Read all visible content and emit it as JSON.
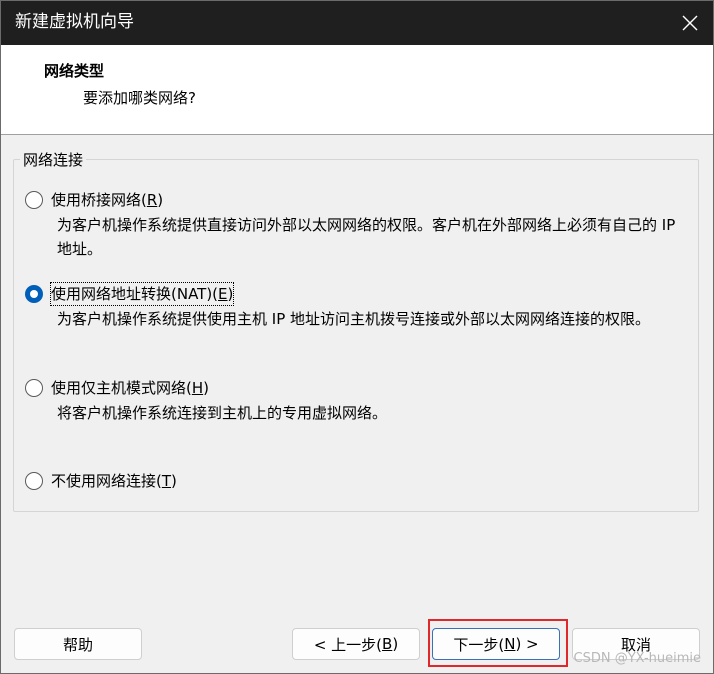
{
  "window": {
    "title": "新建虚拟机向导"
  },
  "header": {
    "title": "网络类型",
    "subtitle": "要添加哪类网络?"
  },
  "group": {
    "label": "网络连接"
  },
  "options": [
    {
      "label_prefix": "使用桥接网络(",
      "hotkey": "R",
      "label_suffix": ")",
      "checked": false,
      "description": "为客户机操作系统提供直接访问外部以太网网络的权限。客户机在外部网络上必须有自己的 IP 地址。"
    },
    {
      "label_prefix": "使用网络地址转换(NAT)(",
      "hotkey": "E",
      "label_suffix": ")",
      "checked": true,
      "description": "为客户机操作系统提供使用主机 IP 地址访问主机拨号连接或外部以太网网络连接的权限。"
    },
    {
      "label_prefix": "使用仅主机模式网络(",
      "hotkey": "H",
      "label_suffix": ")",
      "checked": false,
      "description": "将客户机操作系统连接到主机上的专用虚拟网络。"
    },
    {
      "label_prefix": "不使用网络连接(",
      "hotkey": "T",
      "label_suffix": ")",
      "checked": false,
      "description": ""
    }
  ],
  "buttons": {
    "help": "帮助",
    "back_prefix": "< 上一步(",
    "back_hotkey": "B",
    "back_suffix": ")",
    "next_prefix": "下一步(",
    "next_hotkey": "N",
    "next_suffix": ") >",
    "cancel": "取消"
  },
  "watermark": "CSDN @YX-hueimie",
  "colors": {
    "titlebar": "#1f1f1f",
    "accent": "#005fb8",
    "highlight": "#e0272c"
  },
  "icons": {
    "close": "close-icon"
  }
}
